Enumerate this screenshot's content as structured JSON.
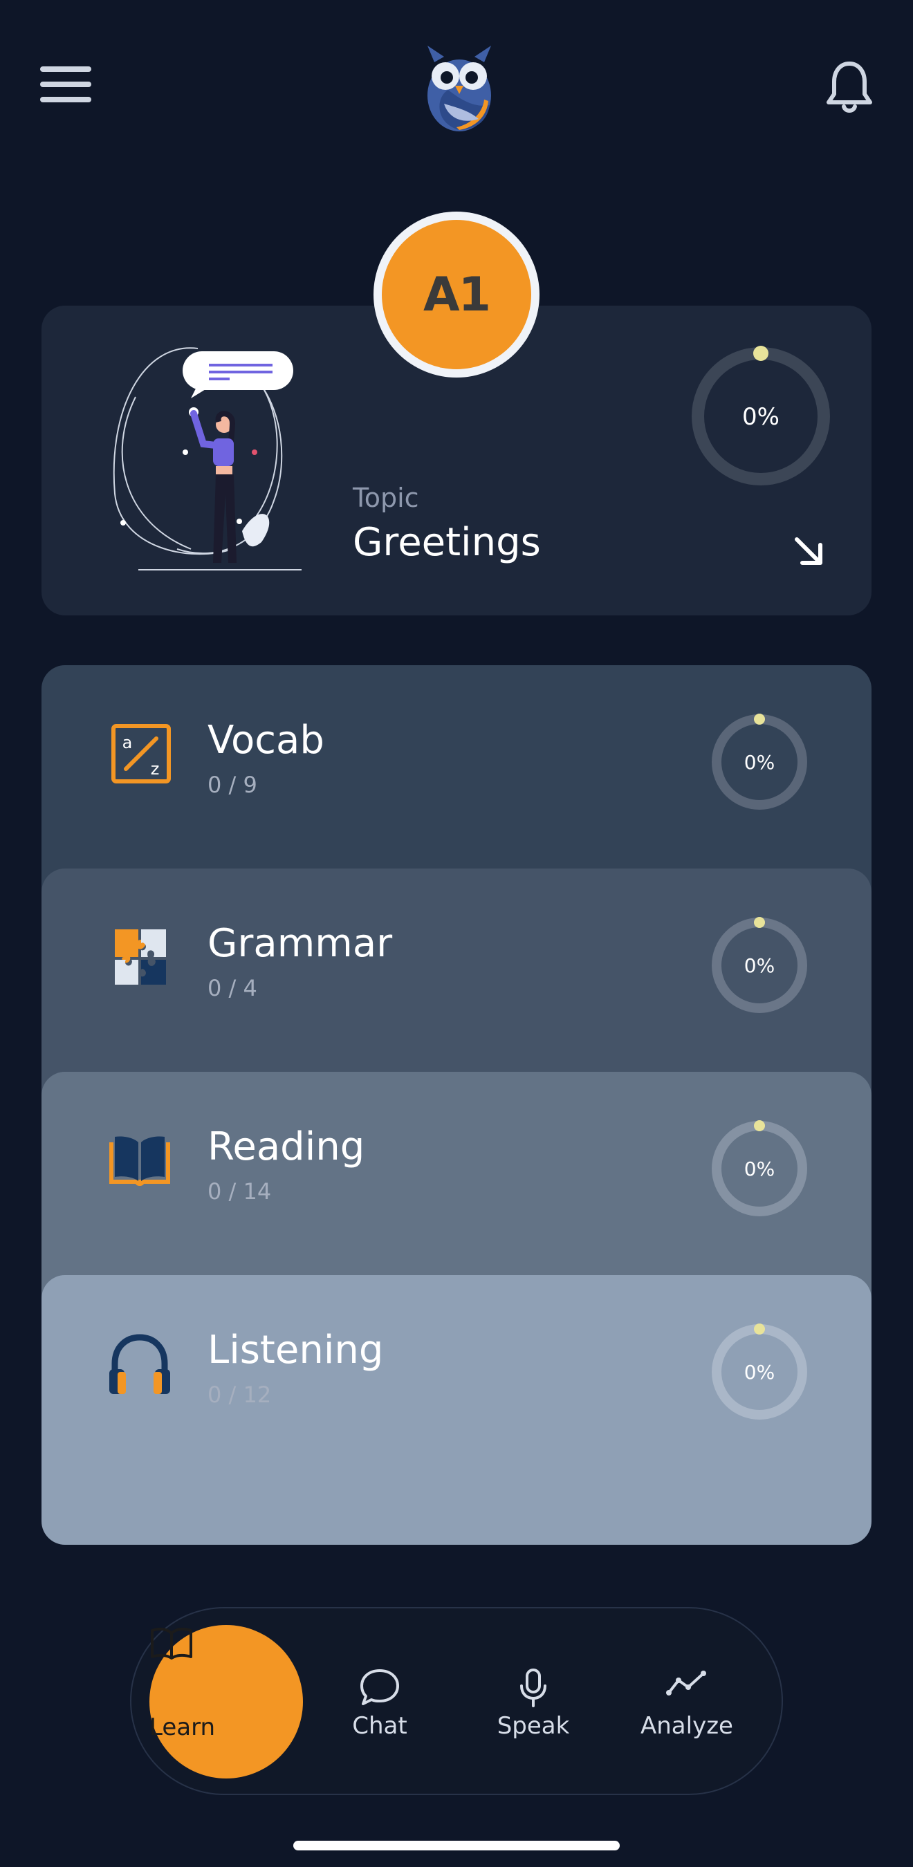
{
  "header": {
    "menu_icon": "hamburger-menu-icon",
    "logo_icon": "owl-logo-icon",
    "notification_icon": "bell-icon"
  },
  "level": {
    "label": "A1",
    "color": "#f39624"
  },
  "topic": {
    "caption": "Topic",
    "title": "Greetings",
    "progress_label": "0%",
    "progress": 0
  },
  "skills": [
    {
      "name": "Vocab",
      "count": "0 / 9",
      "progress_label": "0%",
      "icon": "a-to-z-icon"
    },
    {
      "name": "Grammar",
      "count": "0 / 4",
      "progress_label": "0%",
      "icon": "puzzle-icon"
    },
    {
      "name": "Reading",
      "count": "0 / 14",
      "progress_label": "0%",
      "icon": "book-icon"
    },
    {
      "name": "Listening",
      "count": "0 / 12",
      "progress_label": "0%",
      "icon": "headphones-icon"
    }
  ],
  "nav": {
    "items": [
      {
        "label": "Learn",
        "icon": "book-open-icon",
        "active": true
      },
      {
        "label": "Chat",
        "icon": "chat-bubble-icon",
        "active": false
      },
      {
        "label": "Speak",
        "icon": "microphone-icon",
        "active": false
      },
      {
        "label": "Analyze",
        "icon": "trend-line-icon",
        "active": false
      }
    ]
  },
  "colors": {
    "background": "#0e1628",
    "accent": "#f39624",
    "progress_dot": "#e8e39a"
  }
}
